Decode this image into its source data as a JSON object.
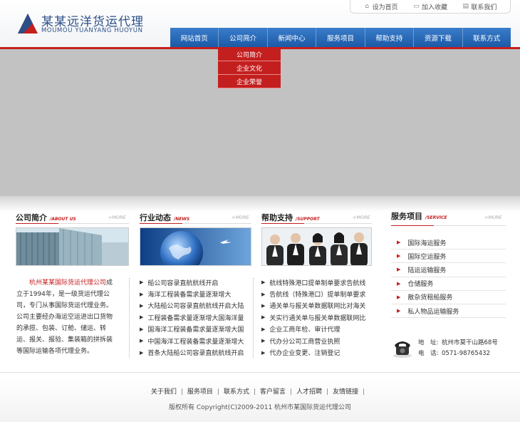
{
  "brand": {
    "name_cn": "某某远洋货运代理",
    "name_en": "MOUMOU YUANYANG HUOYUN",
    "accent": "#c41f1f",
    "nav_color": "#1e5fae"
  },
  "toplinks": [
    {
      "label": "设为首页",
      "icon": "home-icon"
    },
    {
      "label": "加入收藏",
      "icon": "folder-icon"
    },
    {
      "label": "联系我们",
      "icon": "contact-icon"
    }
  ],
  "nav": [
    "网站首页",
    "公司简介",
    "新闻中心",
    "服务项目",
    "帮助支持",
    "资源下载",
    "联系方式"
  ],
  "dropdown": [
    "公司简介",
    "企业文化",
    "企业荣誉"
  ],
  "about": {
    "title": "公司简介",
    "subtitle": "/ABOUT US",
    "more": ">MORE",
    "company": "杭州某某国际货运代理公司",
    "text": "成立于1994年，是一级货运代理公司，专门从事国际货运代理业务。公司主要经办海运空运进出口货物的承揽、包装、订舱、储运、转运、报关、报验、集装箱的拼拆装等国际运输各项代理业务。"
  },
  "news": {
    "title": "行业动态",
    "subtitle": "/NEWS",
    "more": ">MORE",
    "items": [
      "船公司容录直航航线开启",
      "海洋工程装备需求量逐渐增大",
      "大陆船公司容录直航航线开启大陆",
      "工程装备需求量逐渐增大国海洋量",
      "国海洋工程装备需求量逐渐增大国",
      "中国海洋工程装备需求量逐渐增大",
      "首条大陆船公司容录直航航线开启"
    ]
  },
  "support": {
    "title": "帮助支持",
    "subtitle": "/SUPPORT",
    "more": ">MORE",
    "items": [
      "航线特殊港口提单制单要求告航线",
      "告航线（特殊港口）提单制单要求",
      "通关单与报关单数据联网比对海关",
      "关实行通关单与报关单数据联网比",
      "企业工商年检、审计代理",
      "代办分公司工商营业执照",
      "代办企业变更、注销登记"
    ]
  },
  "services": {
    "title": "服务项目",
    "subtitle": "/SERVICE",
    "more": ">MORE",
    "items": [
      "国际海运服务",
      "国际空运服务",
      "陆运运输服务",
      "仓储服务",
      "散杂货租船服务",
      "私人物品运输服务"
    ]
  },
  "contact": {
    "addr_label": "地　址:",
    "addr": "杭州市莫干山路68号",
    "tel_label": "电　话:",
    "tel": "0571-98765432"
  },
  "footer": {
    "links": [
      "关于我们",
      "服务项目",
      "联系方式",
      "客户留言",
      "人才招聘",
      "友情链接"
    ],
    "copyright": "版权所有 Copyright(C)2009-2011 杭州市某国际货运代理公司"
  }
}
